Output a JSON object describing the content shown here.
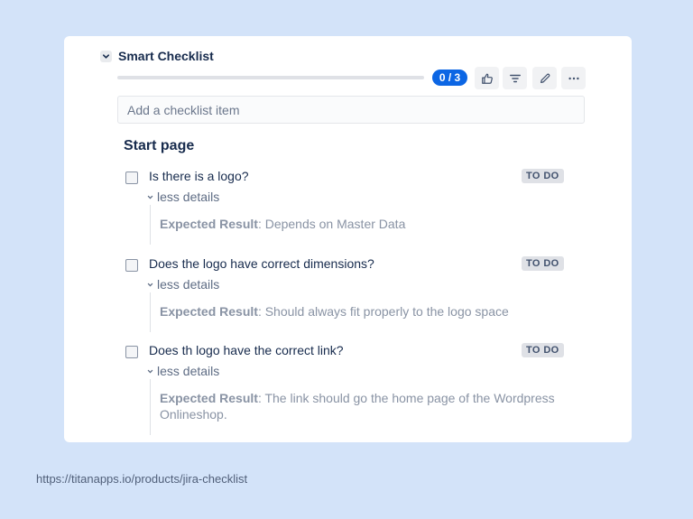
{
  "checklist": {
    "title": "Smart Checklist",
    "progress": {
      "done": 0,
      "total": 3,
      "label": "0 / 3"
    },
    "toolbar": [
      "like-icon",
      "filter-icon",
      "edit-icon",
      "more-icon"
    ],
    "add_placeholder": "Add a checklist item",
    "section_title": "Start page",
    "items": [
      {
        "text": "Is there is a logo?",
        "status": "TO DO",
        "toggle": "less details",
        "detail_label": "Expected Result",
        "detail_text": ": Depends on Master Data"
      },
      {
        "text": "Does the logo have correct dimensions?",
        "status": "TO DO",
        "toggle": "less details",
        "detail_label": "Expected Result",
        "detail_text": ": Should always fit properly to the logo space"
      },
      {
        "text": "Does th logo have the correct link?",
        "status": "TO DO",
        "toggle": "less details",
        "detail_label": "Expected Result",
        "detail_text": ": The link should go the home page of the Wordpress Onlineshop."
      }
    ]
  },
  "footer": {
    "url": "https://titanapps.io/products/jira-checklist"
  },
  "colors": {
    "accent": "#0c66e4",
    "background": "#d3e3f9",
    "card": "#ffffff"
  }
}
